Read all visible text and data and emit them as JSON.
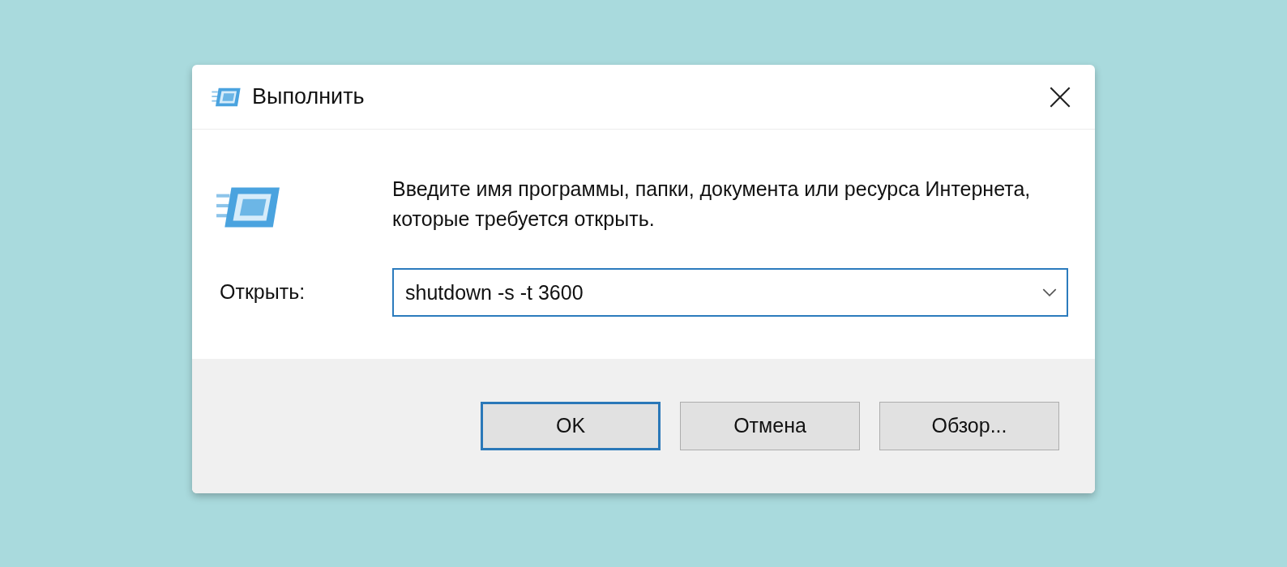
{
  "window": {
    "title": "Выполнить"
  },
  "prompt": "Введите имя программы, папки, документа или ресурса Интернета, которые требуется открыть.",
  "open_field": {
    "label": "Открыть:",
    "value": "shutdown -s -t 3600"
  },
  "buttons": [
    {
      "label": "OK",
      "default": true
    },
    {
      "label": "Отмена",
      "default": false
    },
    {
      "label": "Обзор...",
      "default": false
    }
  ]
}
